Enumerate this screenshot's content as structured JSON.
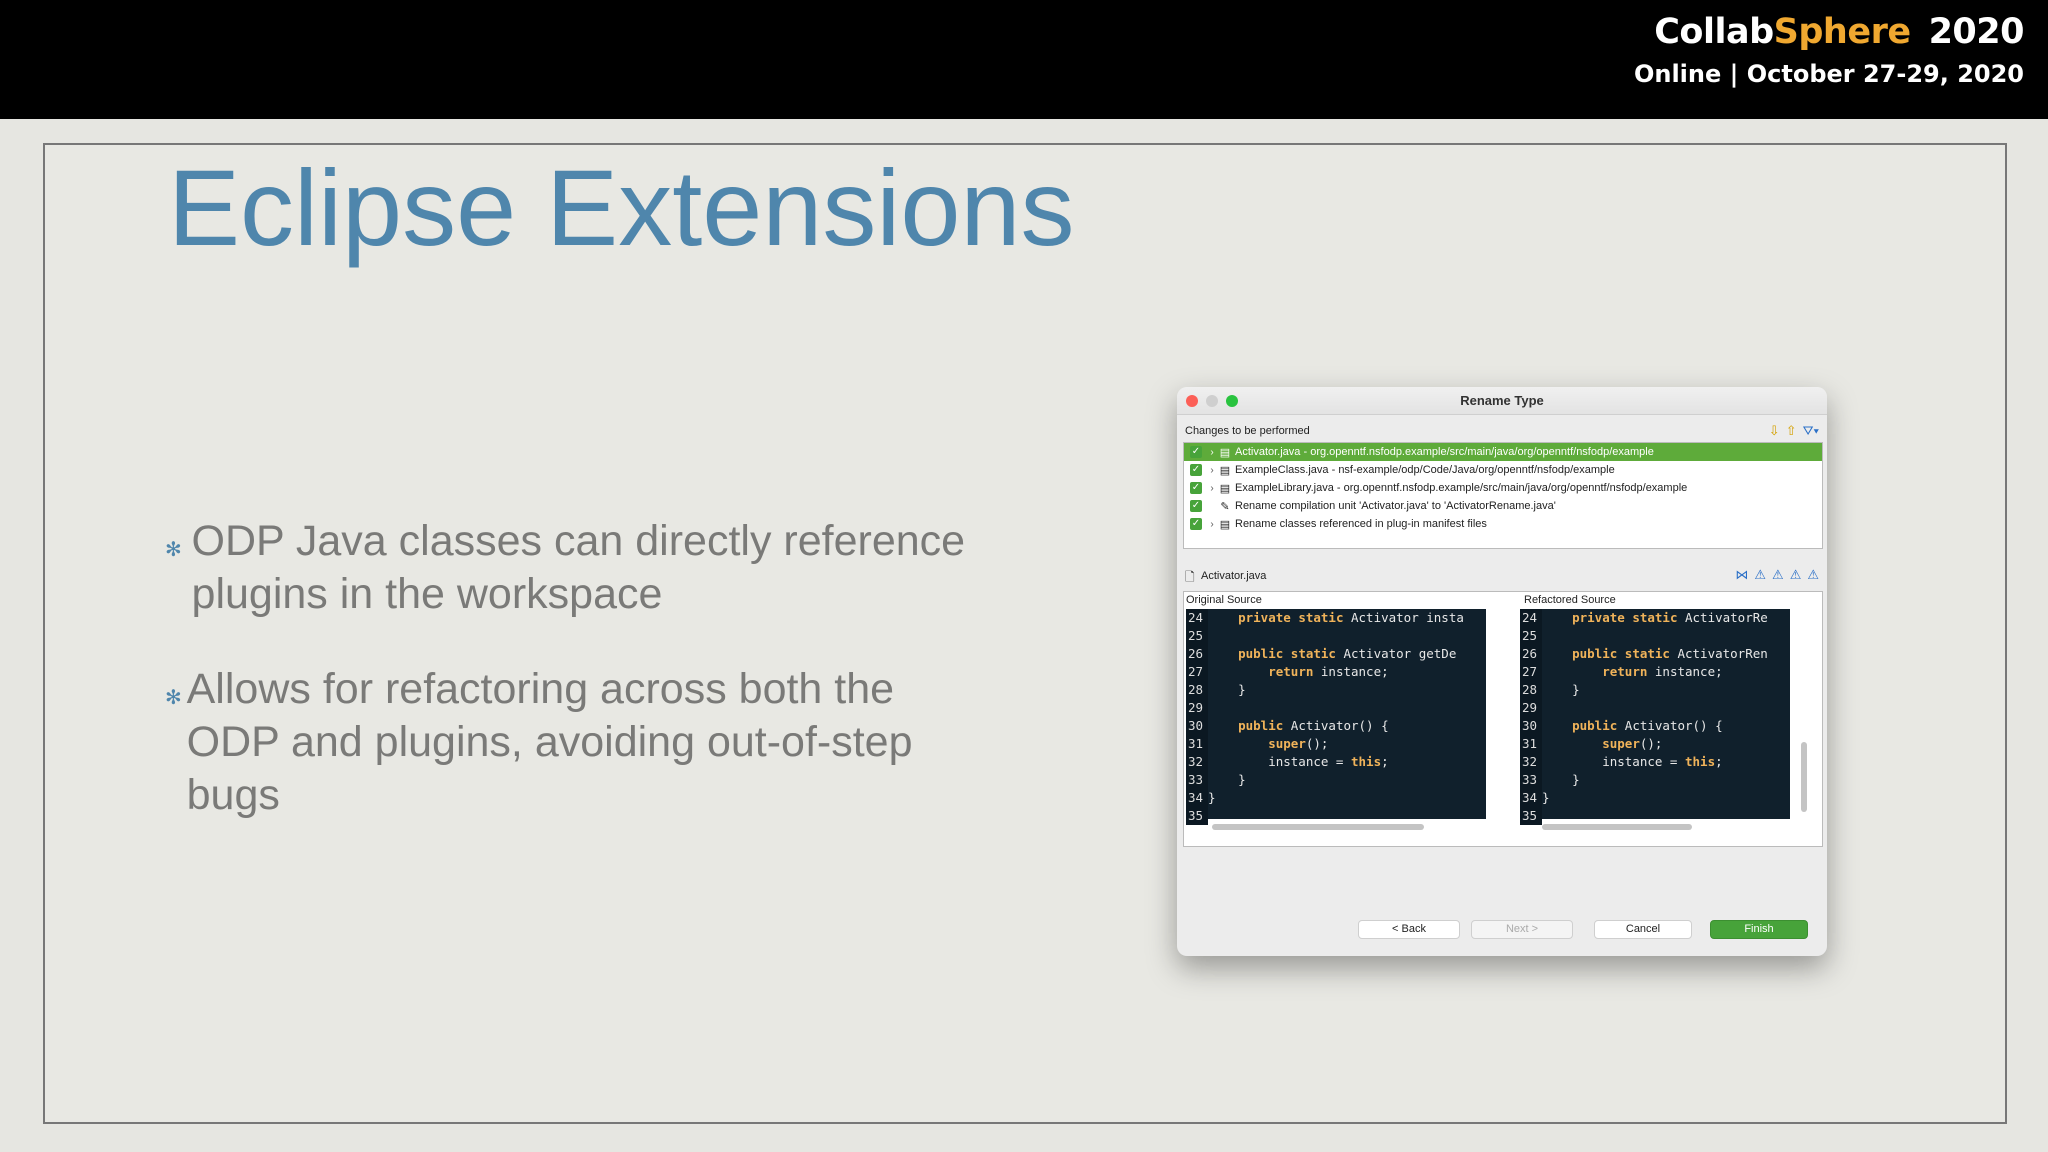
{
  "header": {
    "brand_collab": "Collab",
    "brand_sphere": "Sphere",
    "brand_year": "2020",
    "event_line": "Online | October 27-29, 2020",
    "colors": {
      "sphere": "#f0a830",
      "background": "#000000"
    }
  },
  "slide": {
    "title": "Eclipse Extensions",
    "bullets": [
      "ODP Java classes can directly reference plugins in the workspace",
      "Allows for refactoring across both the ODP and plugins, avoiding out-of-step bugs"
    ],
    "colors": {
      "title": "#4f86ac",
      "text": "#7a7a78"
    }
  },
  "dialog": {
    "title": "Rename Type",
    "changes_label": "Changes to be performed",
    "changes": [
      {
        "text": "Activator.java - org.openntf.nsfodp.example/src/main/java/org/openntf/nsfodp/example",
        "selected": true
      },
      {
        "text": "ExampleClass.java - nsf-example/odp/Code/Java/org/openntf/nsfodp/example",
        "selected": false
      },
      {
        "text": "ExampleLibrary.java - org.openntf.nsfodp.example/src/main/java/org/openntf/nsfodp/example",
        "selected": false
      },
      {
        "text": "Rename compilation unit 'Activator.java' to 'ActivatorRename.java'",
        "selected": false
      },
      {
        "text": "Rename classes referenced in plug-in manifest files",
        "selected": false
      }
    ],
    "file_name": "Activator.java",
    "original_label": "Original Source",
    "refactored_label": "Refactored Source",
    "original_lines": [
      {
        "n": "24",
        "pre": "    ",
        "kw": "private static",
        "rest": " Activator insta"
      },
      {
        "n": "25",
        "pre": "",
        "kw": "",
        "rest": ""
      },
      {
        "n": "26",
        "pre": "    ",
        "kw": "public static",
        "rest": " Activator getDe"
      },
      {
        "n": "27",
        "pre": "        ",
        "kw": "return",
        "rest": " instance;"
      },
      {
        "n": "28",
        "pre": "    }",
        "kw": "",
        "rest": ""
      },
      {
        "n": "29",
        "pre": "",
        "kw": "",
        "rest": ""
      },
      {
        "n": "30",
        "pre": "    ",
        "kw": "public",
        "rest": " Activator() {"
      },
      {
        "n": "31",
        "pre": "        ",
        "kw": "super",
        "rest": "();"
      },
      {
        "n": "32",
        "pre": "        instance = ",
        "kw": "this",
        "rest": ";"
      },
      {
        "n": "33",
        "pre": "    }",
        "kw": "",
        "rest": ""
      },
      {
        "n": "34",
        "pre": "}",
        "kw": "",
        "rest": ""
      },
      {
        "n": "35",
        "pre": "",
        "kw": "",
        "rest": ""
      }
    ],
    "refactored_lines": [
      {
        "n": "24",
        "pre": "    ",
        "kw": "private static",
        "rest": " ActivatorRe"
      },
      {
        "n": "25",
        "pre": "",
        "kw": "",
        "rest": ""
      },
      {
        "n": "26",
        "pre": "    ",
        "kw": "public static",
        "rest": " ActivatorRen"
      },
      {
        "n": "27",
        "pre": "        ",
        "kw": "return",
        "rest": " instance;"
      },
      {
        "n": "28",
        "pre": "    }",
        "kw": "",
        "rest": ""
      },
      {
        "n": "29",
        "pre": "",
        "kw": "",
        "rest": ""
      },
      {
        "n": "30",
        "pre": "    ",
        "kw": "public",
        "rest": " Activator() {"
      },
      {
        "n": "31",
        "pre": "        ",
        "kw": "super",
        "rest": "();"
      },
      {
        "n": "32",
        "pre": "        instance = ",
        "kw": "this",
        "rest": ";"
      },
      {
        "n": "33",
        "pre": "    }",
        "kw": "",
        "rest": ""
      },
      {
        "n": "34",
        "pre": "}",
        "kw": "",
        "rest": ""
      },
      {
        "n": "35",
        "pre": "",
        "kw": "",
        "rest": ""
      }
    ],
    "buttons": {
      "back": "< Back",
      "next": "Next >",
      "cancel": "Cancel",
      "finish": "Finish"
    },
    "icons": [
      "down-arrow-icon",
      "up-arrow-icon",
      "filter-icon",
      "java-file-icon",
      "compare-icon"
    ],
    "colors": {
      "selected": "#5eab3a",
      "finish": "#47a33a",
      "code_bg": "#10202c",
      "keyword": "#f0b35a"
    }
  }
}
